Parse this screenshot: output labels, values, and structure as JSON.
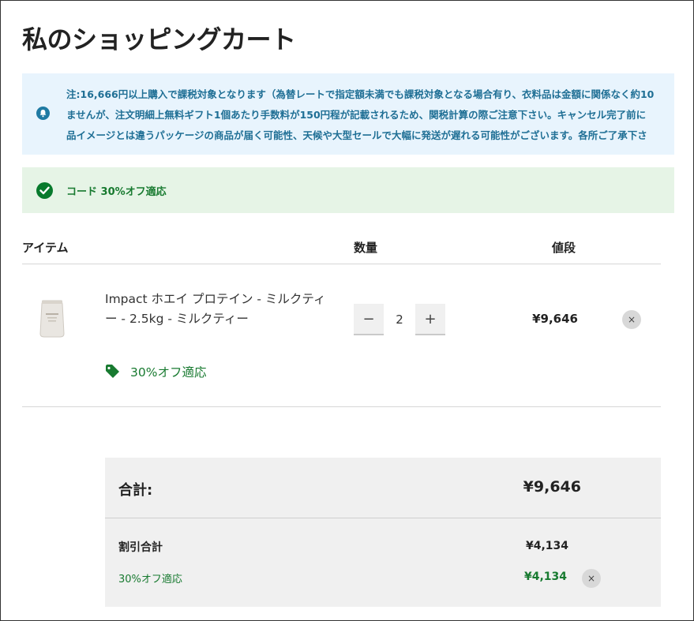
{
  "page": {
    "title": "私のショッピングカート"
  },
  "notice": {
    "icon": "bell-icon",
    "lines": [
      "注:16,666円以上購入で課税対象となります（為替レートで指定額未満でも課税対象となる場合有り、衣料品は金額に関係なく約10",
      "ませんが、注文明細上無料ギフト1個あたり手数料が150円程が記載されるため、関税計算の際ご注意下さい。キャンセル完了前に",
      "品イメージとは違うパッケージの商品が届く可能性、天候や大型セールで大幅に発送が遅れる可能性がございます。各所ご了承下さ"
    ]
  },
  "success": {
    "icon": "check-circle-icon",
    "message": "コード 30%オフ適応"
  },
  "columns": {
    "item": "アイテム",
    "quantity": "数量",
    "price": "値段"
  },
  "cart": {
    "items": [
      {
        "name": "Impact ホエイ プロテイン - ミルクティー - 2.5kg - ミルクティー",
        "quantity": "2",
        "price": "¥9,646",
        "promo": "30%オフ適応",
        "minus_label": "−",
        "plus_label": "+",
        "remove_label": "×"
      }
    ]
  },
  "summary": {
    "total_label": "合計:",
    "total_value": "¥9,646",
    "discount_label": "割引合計",
    "discount_value": "¥4,134",
    "code_label": "30%オフ適応",
    "code_value": "¥4,134",
    "remove_label": "×"
  },
  "colors": {
    "accent_green": "#187a30",
    "notice_blue": "#1f6f95",
    "notice_bg": "#e8f4fd",
    "success_bg": "#e6f4e6"
  }
}
